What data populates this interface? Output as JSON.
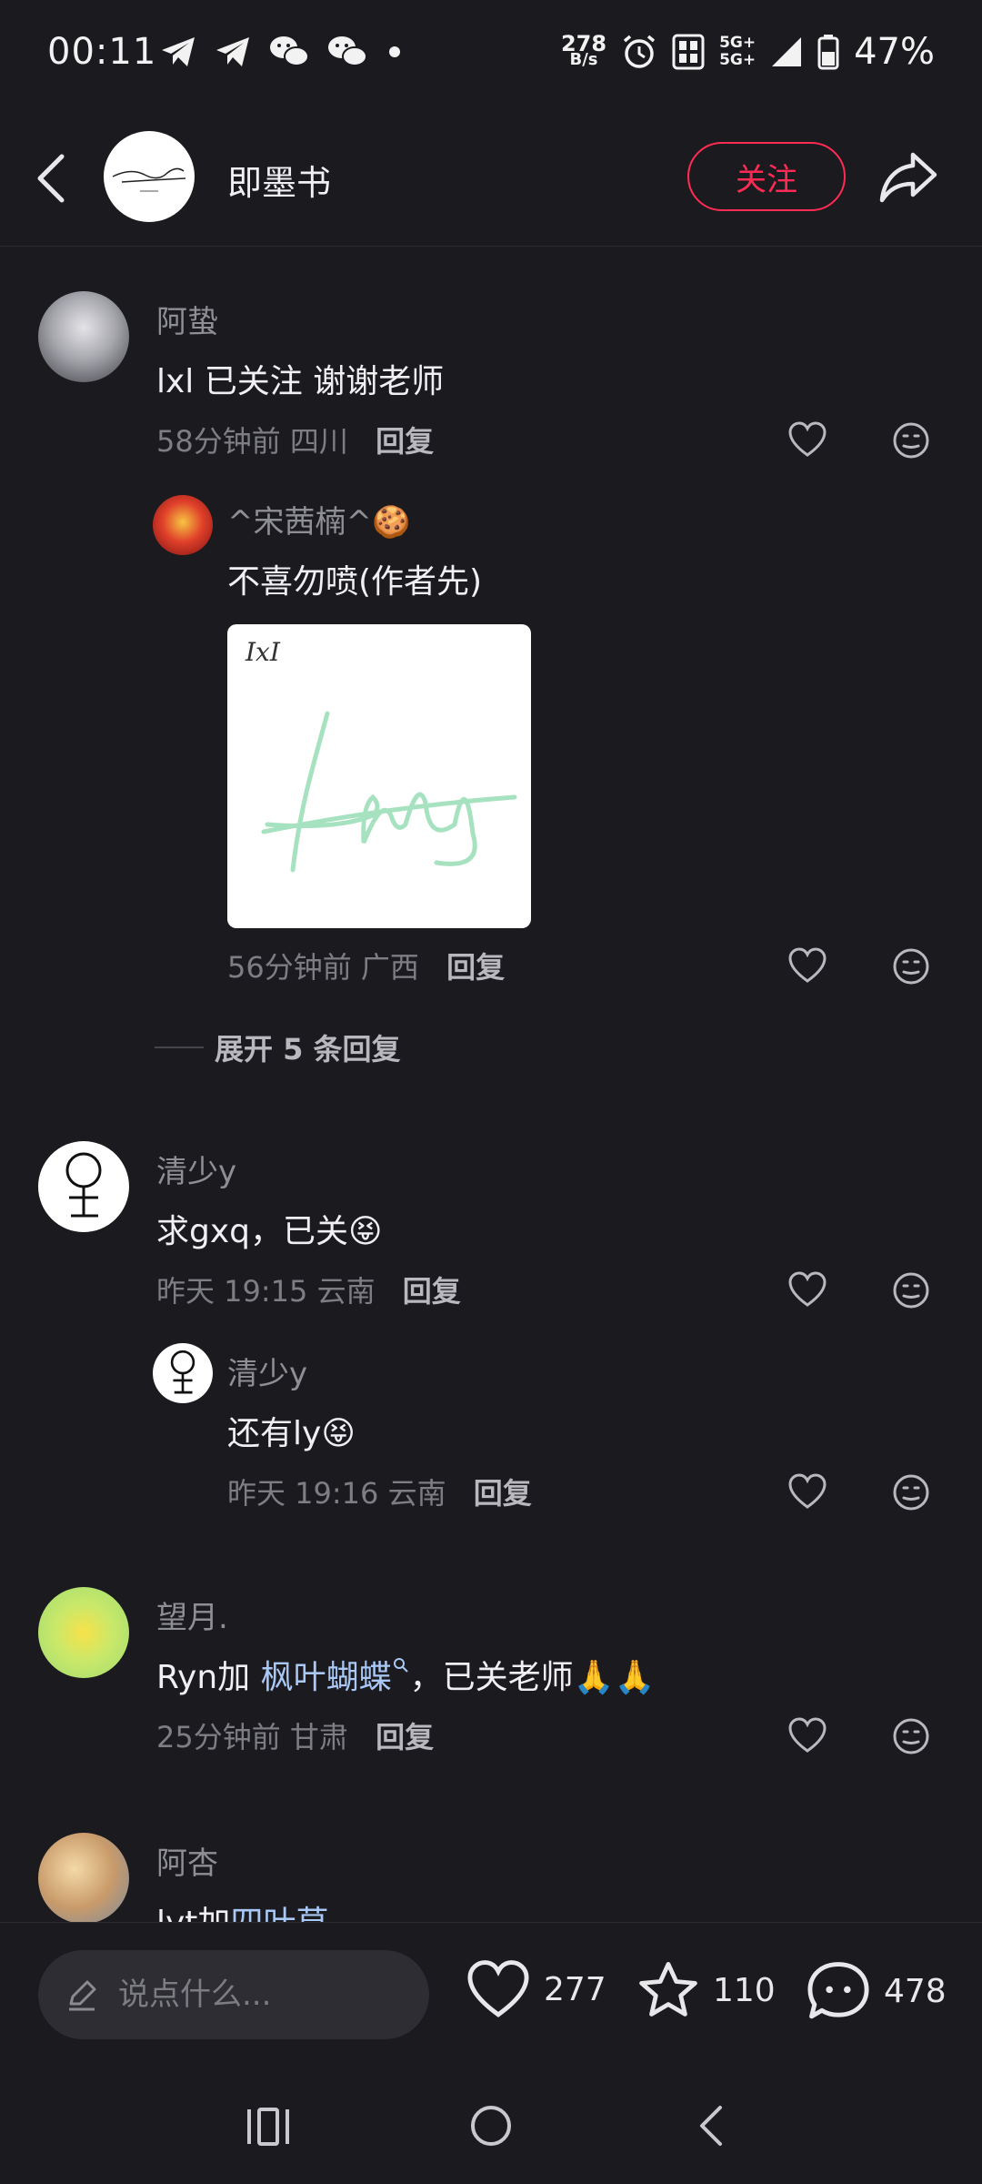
{
  "status_bar": {
    "time": "00:11",
    "net_speed_value": "278",
    "net_speed_unit": "B/s",
    "network": "5G+",
    "battery": "47%"
  },
  "header": {
    "account_name": "即墨书",
    "follow_label": "关注"
  },
  "comments": [
    {
      "user": "阿蛰",
      "text": "lxl 已关注 谢谢老师",
      "time": "58分钟前",
      "location": "四川",
      "reply_label": "回复",
      "replies": [
        {
          "user": "^宋茜楠^",
          "user_emoji": "🍪",
          "text": "不喜勿喷(作者先)",
          "image_caption": "IxI",
          "time": "56分钟前",
          "location": "广西",
          "reply_label": "回复"
        }
      ],
      "expand_label": "展开 5 条回复"
    },
    {
      "user": "清少y",
      "text": "求gxq，已关",
      "text_emoji": "😝",
      "time": "昨天 19:15",
      "location": "云南",
      "reply_label": "回复",
      "replies": [
        {
          "user": "清少y",
          "text": "还有ly",
          "text_emoji": "😝",
          "time": "昨天 19:16",
          "location": "云南",
          "reply_label": "回复"
        }
      ]
    },
    {
      "user": "望月.",
      "text_prefix": "Ryn加 ",
      "link": "枫叶蝴蝶",
      "text_suffix": "，已关老师",
      "text_emoji": "🙏🙏",
      "time": "25分钟前",
      "location": "甘肃",
      "reply_label": "回复"
    },
    {
      "user": "阿杏",
      "text_prefix": "lyt加",
      "link": "四叶草"
    }
  ],
  "bottom_bar": {
    "input_placeholder": "说点什么...",
    "likes": "277",
    "stars": "110",
    "comments": "478"
  },
  "colors": {
    "background": "#1a1a1f",
    "accent": "#ff2b54",
    "link": "#a9c8f5"
  }
}
